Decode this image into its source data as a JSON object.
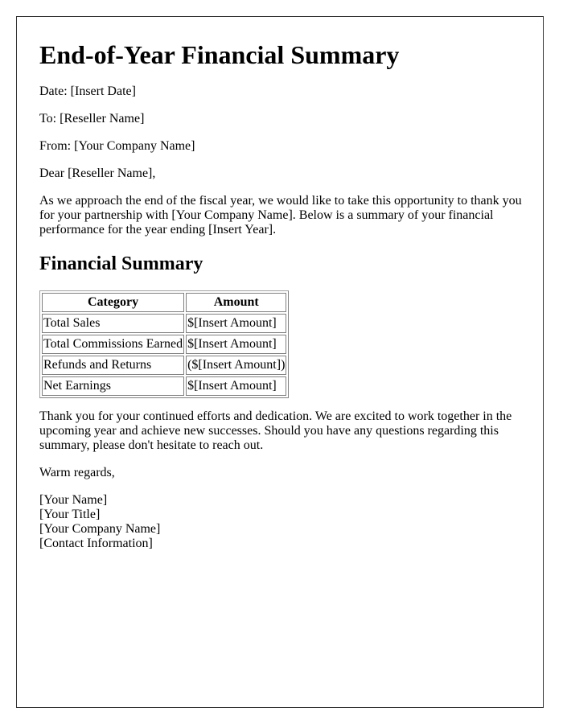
{
  "title": "End-of-Year Financial Summary",
  "header_fields": [
    {
      "label": "Date:",
      "value": "[Insert Date]"
    },
    {
      "label": "To:",
      "value": "[Reseller Name]"
    },
    {
      "label": "From:",
      "value": "[Your Company Name]"
    }
  ],
  "salutation": "Dear [Reseller Name],",
  "intro_paragraph": "As we approach the end of the fiscal year, we would like to take this opportunity to thank you for your partnership with [Your Company Name]. Below is a summary of your financial performance for the year ending [Insert Year].",
  "section_heading": "Financial Summary",
  "table": {
    "headers": [
      "Category",
      "Amount"
    ],
    "rows": [
      [
        "Total Sales",
        "$[Insert Amount]"
      ],
      [
        "Total Commissions Earned",
        "$[Insert Amount]"
      ],
      [
        "Refunds and Returns",
        "($[Insert Amount])"
      ],
      [
        "Net Earnings",
        "$[Insert Amount]"
      ]
    ]
  },
  "closing_paragraph": "Thank you for your continued efforts and dedication. We are excited to work together in the upcoming year and achieve new successes. Should you have any questions regarding this summary, please don't hesitate to reach out.",
  "sign_off": "Warm regards,",
  "signature": {
    "name": "[Your Name]",
    "title": "[Your Title]",
    "company": "[Your Company Name]",
    "contact": "[Contact Information]"
  }
}
